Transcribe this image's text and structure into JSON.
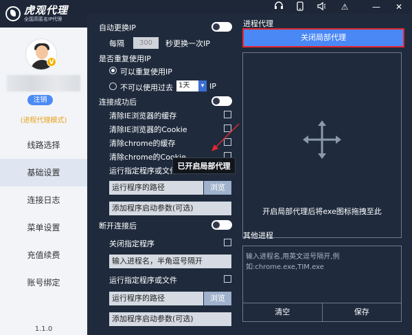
{
  "app": {
    "logo_title": "虎观代理",
    "logo_sub": "全国高匿名IP代理",
    "logout": "注销",
    "mode": "(进程代理模式)",
    "version": "1.1.0",
    "vip_badge": "V"
  },
  "nav": {
    "items": [
      {
        "label": "线路选择"
      },
      {
        "label": "基础设置"
      },
      {
        "label": "连接日志"
      },
      {
        "label": "菜单设置"
      },
      {
        "label": "充值续费"
      },
      {
        "label": "账号绑定"
      }
    ],
    "active": "基础设置"
  },
  "topbar": {
    "icons": [
      "headset-icon",
      "phone-icon",
      "speaker-icon",
      "warning-icon",
      "minimize-icon",
      "close-icon"
    ],
    "glyphs": {
      "minimize": "—",
      "close": "✕",
      "warning": "⚠"
    }
  },
  "settings": {
    "auto_ip": "自动更换IP",
    "every": "每隔",
    "interval_value": "300",
    "interval_suffix": "秒更换一次IP",
    "reuse_q": "是否重复使用IP",
    "reuse_yes": "可以重复使用IP",
    "reuse_no": "不可以使用过去",
    "reuse_days": "1天",
    "reuse_unit": "IP",
    "after_connect": "连接成功后",
    "clear_ie_cache": "清除IE浏览器的缓存",
    "clear_ie_cookie": "清除IE浏览器的Cookie",
    "clear_chrome_cache": "清除chrome的缓存",
    "clear_chrome_cookie": "清除chrome的Cookie",
    "run_program_1": "运行指定程序或文件",
    "program_path_1": "运行程序的路径",
    "browse_1": "浏览",
    "program_args_1": "添加程序启动参数(可选)",
    "after_disconnect": "断开连接后",
    "close_program": "关闭指定程序",
    "process_names": "输入进程名，半角逗号隔开",
    "run_program_2": "运行指定程序或文件",
    "program_path_2": "运行程序的路径",
    "browse_2": "浏览",
    "program_args_2": "添加程序启动参数(可选)"
  },
  "process_proxy": {
    "title": "进程代理",
    "close_button": "关闭局部代理",
    "drop_hint": "开启局部代理后将exe图标拖拽至此",
    "other_title": "其他进程",
    "other_placeholder": "输入进程名,用英文逗号隔开,例如:chrome.exe,TIM.exe",
    "clear_button": "清空",
    "save_button": "保存"
  },
  "tooltip": "已开启局部代理",
  "colors": {
    "accent": "#4a88f5",
    "panel": "#1f2b3d",
    "sidebar": "#f2f4f7",
    "highlight_border": "#e3262e",
    "mode_text": "#e9a21a"
  }
}
